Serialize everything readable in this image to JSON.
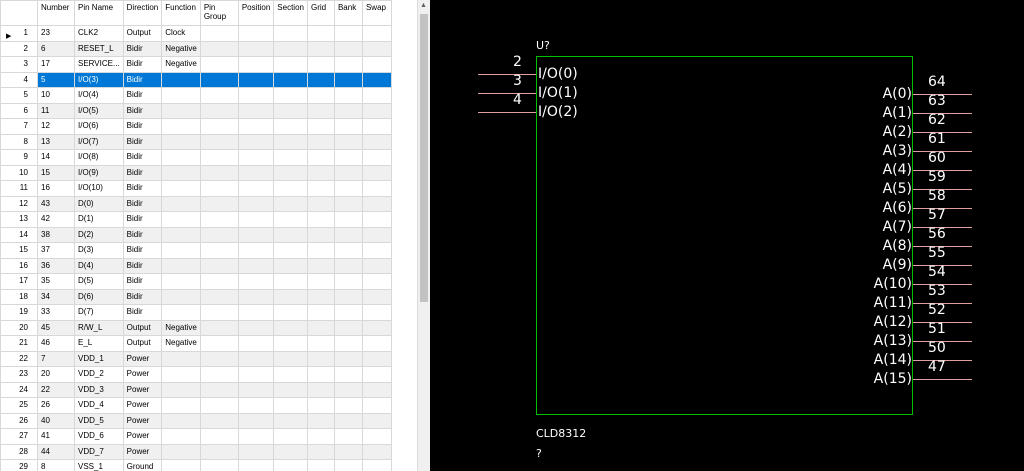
{
  "grid": {
    "headers": [
      "",
      "Number",
      "Pin Name",
      "Direction",
      "Function",
      "Pin Group",
      "Position",
      "Section",
      "Grid",
      "Bank",
      "Swap"
    ],
    "selected_row": 4,
    "rows": [
      [
        "1",
        "23",
        "CLK2",
        "Output",
        "Clock"
      ],
      [
        "2",
        "6",
        "RESET_L",
        "Bidir",
        "Negative"
      ],
      [
        "3",
        "17",
        "SERVICE...",
        "Bidir",
        "Negative"
      ],
      [
        "4",
        "5",
        "I/O(3)",
        "Bidir",
        ""
      ],
      [
        "5",
        "10",
        "I/O(4)",
        "Bidir",
        ""
      ],
      [
        "6",
        "11",
        "I/O(5)",
        "Bidir",
        ""
      ],
      [
        "7",
        "12",
        "I/O(6)",
        "Bidir",
        ""
      ],
      [
        "8",
        "13",
        "I/O(7)",
        "Bidir",
        ""
      ],
      [
        "9",
        "14",
        "I/O(8)",
        "Bidir",
        ""
      ],
      [
        "10",
        "15",
        "I/O(9)",
        "Bidir",
        ""
      ],
      [
        "11",
        "16",
        "I/O(10)",
        "Bidir",
        ""
      ],
      [
        "12",
        "43",
        "D(0)",
        "Bidir",
        ""
      ],
      [
        "13",
        "42",
        "D(1)",
        "Bidir",
        ""
      ],
      [
        "14",
        "38",
        "D(2)",
        "Bidir",
        ""
      ],
      [
        "15",
        "37",
        "D(3)",
        "Bidir",
        ""
      ],
      [
        "16",
        "36",
        "D(4)",
        "Bidir",
        ""
      ],
      [
        "17",
        "35",
        "D(5)",
        "Bidir",
        ""
      ],
      [
        "18",
        "34",
        "D(6)",
        "Bidir",
        ""
      ],
      [
        "19",
        "33",
        "D(7)",
        "Bidir",
        ""
      ],
      [
        "20",
        "45",
        "R/W_L",
        "Output",
        "Negative"
      ],
      [
        "21",
        "46",
        "E_L",
        "Output",
        "Negative"
      ],
      [
        "22",
        "7",
        "VDD_1",
        "Power",
        ""
      ],
      [
        "23",
        "20",
        "VDD_2",
        "Power",
        ""
      ],
      [
        "24",
        "22",
        "VDD_3",
        "Power",
        ""
      ],
      [
        "25",
        "26",
        "VDD_4",
        "Power",
        ""
      ],
      [
        "26",
        "40",
        "VDD_5",
        "Power",
        ""
      ],
      [
        "27",
        "41",
        "VDD_6",
        "Power",
        ""
      ],
      [
        "28",
        "44",
        "VDD_7",
        "Power",
        ""
      ],
      [
        "29",
        "8",
        "VSS_1",
        "Ground",
        ""
      ]
    ]
  },
  "symbol": {
    "ref_designator": "U?",
    "part_name": "CLD8312",
    "value": "?",
    "left_pins": [
      {
        "number": "2",
        "name": "I/O(0)"
      },
      {
        "number": "3",
        "name": "I/O(1)"
      },
      {
        "number": "4",
        "name": "I/O(2)"
      }
    ],
    "right_pins": [
      {
        "number": "64",
        "name": "A(0)"
      },
      {
        "number": "63",
        "name": "A(1)"
      },
      {
        "number": "62",
        "name": "A(2)"
      },
      {
        "number": "61",
        "name": "A(3)"
      },
      {
        "number": "60",
        "name": "A(4)"
      },
      {
        "number": "59",
        "name": "A(5)"
      },
      {
        "number": "58",
        "name": "A(6)"
      },
      {
        "number": "57",
        "name": "A(7)"
      },
      {
        "number": "56",
        "name": "A(8)"
      },
      {
        "number": "55",
        "name": "A(9)"
      },
      {
        "number": "54",
        "name": "A(10)"
      },
      {
        "number": "53",
        "name": "A(11)"
      },
      {
        "number": "52",
        "name": "A(12)"
      },
      {
        "number": "51",
        "name": "A(13)"
      },
      {
        "number": "50",
        "name": "A(14)"
      },
      {
        "number": "47",
        "name": "A(15)"
      }
    ]
  },
  "colors": {
    "selection": "#0078d7",
    "body_outline": "#00c000",
    "pin_line": "#e0a0a0",
    "canvas_bg": "#000000"
  },
  "icons": {
    "current_row": "row-pointer-icon",
    "scroll_up": "scroll-up-arrow-icon"
  }
}
